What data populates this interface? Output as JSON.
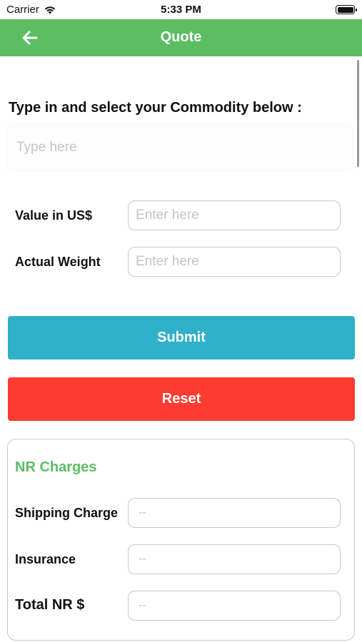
{
  "status_bar": {
    "carrier": "Carrier",
    "time": "5:33 PM"
  },
  "nav": {
    "title": "Quote",
    "back_icon": "arrow-left-icon"
  },
  "commodity": {
    "label": "Type in and select your Commodity below :",
    "placeholder": "Type here"
  },
  "fields": {
    "value_label": "Value in US$",
    "value_placeholder": "Enter here",
    "weight_label": "Actual Weight",
    "weight_placeholder": "Enter here"
  },
  "buttons": {
    "submit": "Submit",
    "reset": "Reset"
  },
  "charges": {
    "title": "NR Charges",
    "shipping_label": "Shipping Charge",
    "shipping_value": "--",
    "insurance_label": "Insurance",
    "insurance_value": "--",
    "total_label": "Total NR  $",
    "total_value": "--"
  },
  "colors": {
    "nav_green": "#5cbd63",
    "submit_blue": "#31b0c9",
    "reset_red": "#fc3c30"
  }
}
